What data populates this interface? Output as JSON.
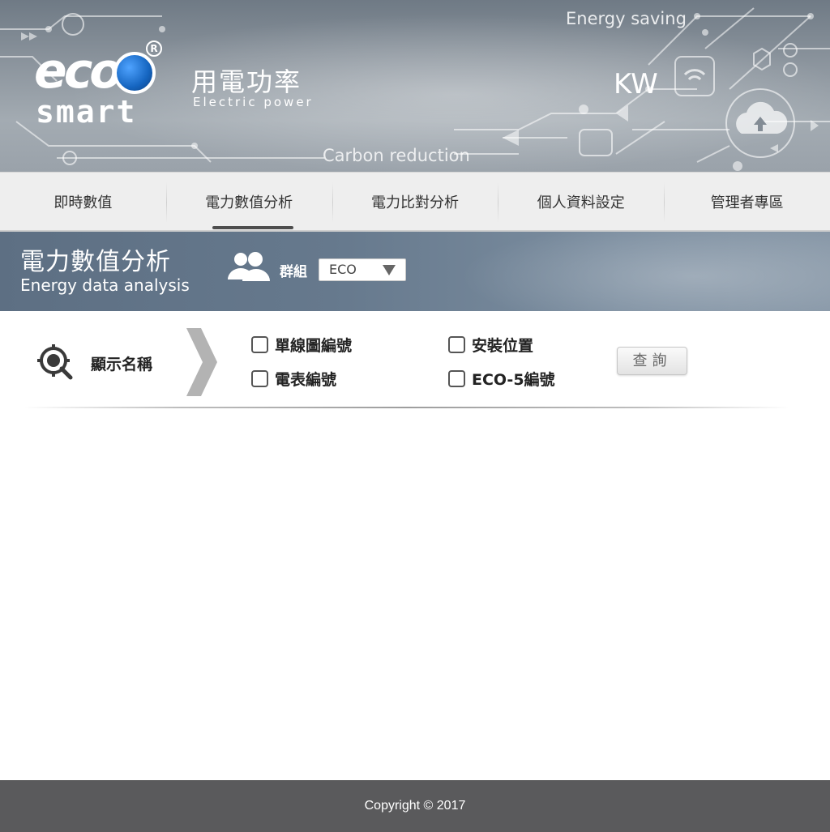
{
  "header": {
    "brand_top": "eco",
    "brand_bottom": "smart",
    "brand_reg": "R",
    "title_zh": "用電功率",
    "title_en": "Electric power",
    "energy_saving": "Energy saving",
    "unit": "KW",
    "carbon_reduction": "Carbon reduction"
  },
  "nav": {
    "tabs": [
      {
        "label": "即時數值"
      },
      {
        "label": "電力數值分析"
      },
      {
        "label": "電力比對分析"
      },
      {
        "label": "個人資料設定"
      },
      {
        "label": "管理者專區"
      }
    ],
    "active_index": 1
  },
  "section": {
    "title_zh": "電力數值分析",
    "title_en": "Energy data analysis",
    "group_label": "群組",
    "group_value": "ECO"
  },
  "filter": {
    "display_name": "顯示名稱",
    "options": [
      {
        "label": "單線圖編號",
        "checked": false
      },
      {
        "label": "安裝位置",
        "checked": false
      },
      {
        "label": "電表編號",
        "checked": false
      },
      {
        "label": "ECO-5編號",
        "checked": false
      }
    ],
    "query_label": "查詢"
  },
  "footer": {
    "copyright": "Copyright © 2017"
  },
  "colors": {
    "nav_bg": "#eeeeee",
    "footer_bg": "#5a5a5c",
    "banner_bg": "#66798d",
    "active_underline": "#4d4d4d"
  }
}
